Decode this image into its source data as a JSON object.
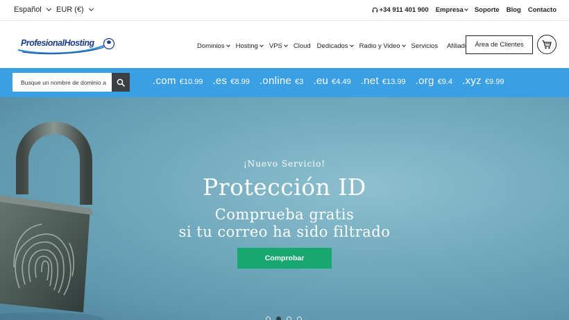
{
  "topbar": {
    "language": "Español",
    "currency": "EUR (€)",
    "phone": "+34 911 401 900",
    "links": [
      "Empresa",
      "Soporte",
      "Blog",
      "Contacto"
    ]
  },
  "header": {
    "logo_text": "ProfesionalHosting",
    "nav": [
      {
        "label": "Dominios",
        "dropdown": true
      },
      {
        "label": "Hosting",
        "dropdown": true
      },
      {
        "label": "VPS",
        "dropdown": true
      },
      {
        "label": "Cloud",
        "dropdown": false
      },
      {
        "label": "Dedicados",
        "dropdown": true
      },
      {
        "label": "Radio y Video",
        "dropdown": true
      },
      {
        "label": "Servicios",
        "dropdown": false
      },
      {
        "label": "Afiliados",
        "dropdown": false
      }
    ],
    "clients_button": "Área de Clientes"
  },
  "domain_search": {
    "placeholder": "Busque un nombre de dominio a",
    "tlds": [
      {
        "ext": ".com",
        "price": "€10.99"
      },
      {
        "ext": ".es",
        "price": "€8.99"
      },
      {
        "ext": ".online",
        "price": "€3"
      },
      {
        "ext": ".eu",
        "price": "€4.49"
      },
      {
        "ext": ".net",
        "price": "€13.99"
      },
      {
        "ext": ".org",
        "price": "€9.4"
      },
      {
        "ext": ".xyz",
        "price": "€9.99"
      }
    ]
  },
  "hero": {
    "kicker": "¡Nuevo Servicio!",
    "title": "Protección ID",
    "subtitle_line1": "Comprueba gratis",
    "subtitle_line2": "si tu correo ha sido filtrado",
    "cta": "Comprobar",
    "slides": 4,
    "active_slide": 2
  },
  "colors": {
    "domain_bar": "#3b9fe3",
    "cta": "#16a870",
    "search_button": "#3a3f44"
  }
}
